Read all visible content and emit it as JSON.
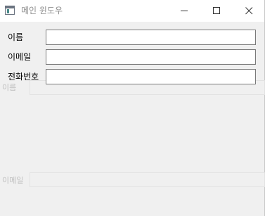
{
  "window": {
    "title": "메인 윈도우",
    "icon": "app-window-icon",
    "controls": {
      "minimize_icon": "minimize-icon",
      "maximize_icon": "maximize-icon",
      "close_icon": "close-icon"
    }
  },
  "form": {
    "name_label": "이름",
    "name_value": "",
    "email_label": "이메일",
    "email_value": "",
    "phone_label": "전화번호",
    "phone_value": ""
  },
  "background_form": {
    "name_label": "이름",
    "email_label": "이메일"
  },
  "colors": {
    "window_bg": "#f0f0f0",
    "titlebar_bg": "#ffffff",
    "title_text": "#8f8f8f",
    "field_border": "#7a7a7a",
    "ghost_text": "#c0c0c0"
  }
}
